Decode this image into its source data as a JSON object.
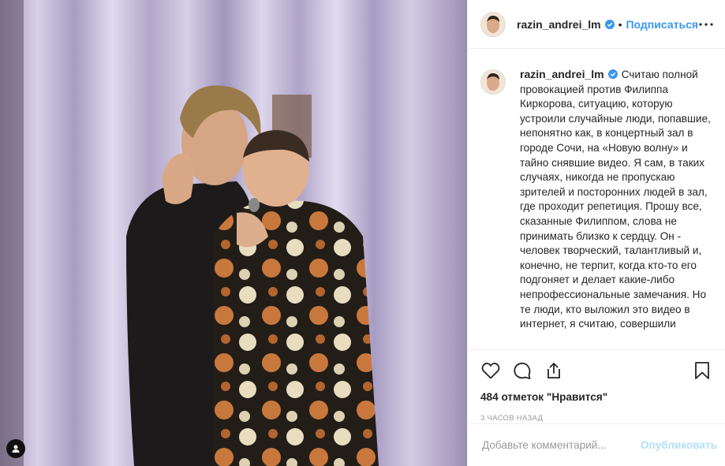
{
  "post": {
    "username": "razin_andrei_lm",
    "separator": "•",
    "follow_label": "Подписаться",
    "caption": "Считаю полной провокацией против Филиппа Киркорова, ситуацию, которую устроили случайные люди, попавшие, непонятно как, в концертный зал в городе Сочи, на «Новую волну» и тайно снявшие видео. Я сам, в таких случаях, никогда не пропускаю зрителей и посторонних людей в зал, где проходит репетиция. Прошу все, сказанные Филиппом, слова не принимать близко к сердцу. Он - человек творческий, талантливый и, конечно, не терпит, когда кто-то его подгоняет и делает какие-либо непрофессиональные замечания. Но те люди, кто выложил это видео в интернет, я считаю, совершили",
    "likes": "484 отметок \"Нравится\"",
    "time_ago": "3 часов назад",
    "comment_placeholder": "Добавьте комментарий...",
    "publish_label": "Опубликовать"
  },
  "icons": {
    "verified": "verified-badge-icon",
    "more": "more-options-icon",
    "like": "heart-icon",
    "comment": "comment-bubble-icon",
    "share": "share-icon",
    "save": "bookmark-icon",
    "user_tag": "user-tag-icon"
  },
  "colors": {
    "accent": "#3897f0",
    "verified": "#3897f0",
    "publish_disabled": "#b2dffc",
    "text": "#262626",
    "muted": "#999999"
  }
}
